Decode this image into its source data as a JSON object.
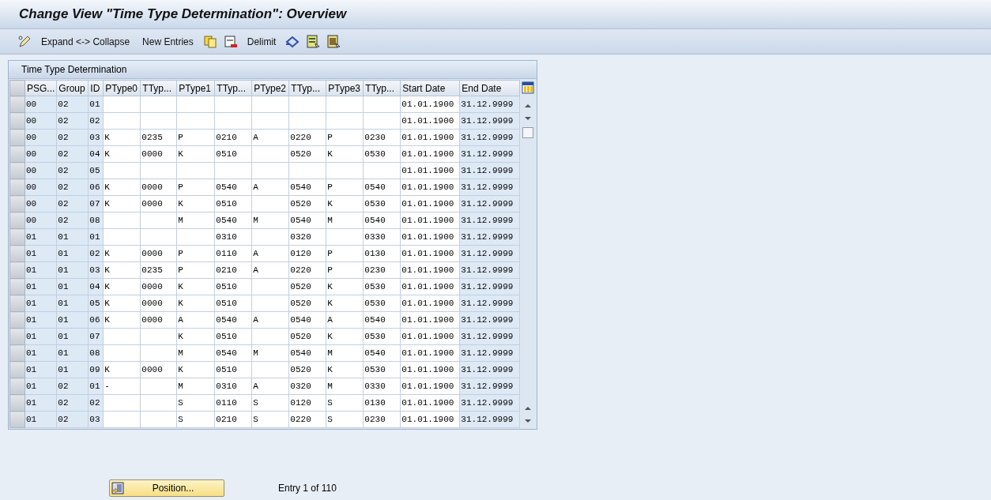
{
  "window": {
    "title": "Change View \"Time Type Determination\": Overview"
  },
  "toolbar": {
    "buttons": [
      "Expand <-> Collapse",
      "New Entries",
      "Delimit"
    ]
  },
  "table": {
    "title": "Time Type Determination",
    "columns": [
      {
        "label": "PSG...",
        "key": true
      },
      {
        "label": "Group",
        "key": true
      },
      {
        "label": "ID",
        "key": true
      },
      {
        "label": "PType0",
        "key": false
      },
      {
        "label": "TTyp...",
        "key": false
      },
      {
        "label": "PType1",
        "key": false
      },
      {
        "label": "TTyp...",
        "key": false
      },
      {
        "label": "PType2",
        "key": false
      },
      {
        "label": "TTyp...",
        "key": false
      },
      {
        "label": "PType3",
        "key": false
      },
      {
        "label": "TTyp...",
        "key": false
      },
      {
        "label": "Start Date",
        "key": false
      },
      {
        "label": "End Date",
        "key": true
      }
    ],
    "rows": [
      [
        "00",
        "02",
        "01",
        null,
        null,
        null,
        null,
        null,
        null,
        null,
        null,
        "01.01.1900",
        "31.12.9999"
      ],
      [
        "00",
        "02",
        "02",
        null,
        null,
        null,
        null,
        null,
        null,
        null,
        null,
        "01.01.1900",
        "31.12.9999"
      ],
      [
        "00",
        "02",
        "03",
        "K",
        "0235",
        "P",
        "0210",
        "A",
        "0220",
        "P",
        "0230",
        "01.01.1900",
        "31.12.9999"
      ],
      [
        "00",
        "02",
        "04",
        "K",
        "0000",
        "K",
        "0510",
        null,
        "0520",
        "K",
        "0530",
        "01.01.1900",
        "31.12.9999"
      ],
      [
        "00",
        "02",
        "05",
        null,
        null,
        null,
        null,
        null,
        null,
        null,
        null,
        "01.01.1900",
        "31.12.9999"
      ],
      [
        "00",
        "02",
        "06",
        "K",
        "0000",
        "P",
        "0540",
        "A",
        "0540",
        "P",
        "0540",
        "01.01.1900",
        "31.12.9999"
      ],
      [
        "00",
        "02",
        "07",
        "K",
        "0000",
        "K",
        "0510",
        null,
        "0520",
        "K",
        "0530",
        "01.01.1900",
        "31.12.9999"
      ],
      [
        "00",
        "02",
        "08",
        null,
        null,
        "M",
        "0540",
        "M",
        "0540",
        "M",
        "0540",
        "01.01.1900",
        "31.12.9999"
      ],
      [
        "01",
        "01",
        "01",
        null,
        null,
        null,
        "0310",
        null,
        "0320",
        null,
        "0330",
        "01.01.1900",
        "31.12.9999"
      ],
      [
        "01",
        "01",
        "02",
        "K",
        "0000",
        "P",
        "0110",
        "A",
        "0120",
        "P",
        "0130",
        "01.01.1900",
        "31.12.9999"
      ],
      [
        "01",
        "01",
        "03",
        "K",
        "0235",
        "P",
        "0210",
        "A",
        "0220",
        "P",
        "0230",
        "01.01.1900",
        "31.12.9999"
      ],
      [
        "01",
        "01",
        "04",
        "K",
        "0000",
        "K",
        "0510",
        null,
        "0520",
        "K",
        "0530",
        "01.01.1900",
        "31.12.9999"
      ],
      [
        "01",
        "01",
        "05",
        "K",
        "0000",
        "K",
        "0510",
        null,
        "0520",
        "K",
        "0530",
        "01.01.1900",
        "31.12.9999"
      ],
      [
        "01",
        "01",
        "06",
        "K",
        "0000",
        "A",
        "0540",
        "A",
        "0540",
        "A",
        "0540",
        "01.01.1900",
        "31.12.9999"
      ],
      [
        "01",
        "01",
        "07",
        null,
        null,
        "K",
        "0510",
        null,
        "0520",
        "K",
        "0530",
        "01.01.1900",
        "31.12.9999"
      ],
      [
        "01",
        "01",
        "08",
        null,
        null,
        "M",
        "0540",
        "M",
        "0540",
        "M",
        "0540",
        "01.01.1900",
        "31.12.9999"
      ],
      [
        "01",
        "01",
        "09",
        "K",
        "0000",
        "K",
        "0510",
        null,
        "0520",
        "K",
        "0530",
        "01.01.1900",
        "31.12.9999"
      ],
      [
        "01",
        "02",
        "01",
        "-",
        null,
        "M",
        "0310",
        "A",
        "0320",
        "M",
        "0330",
        "01.01.1900",
        "31.12.9999"
      ],
      [
        "01",
        "02",
        "02",
        null,
        null,
        "S",
        "0110",
        "S",
        "0120",
        "S",
        "0130",
        "01.01.1900",
        "31.12.9999"
      ],
      [
        "01",
        "02",
        "03",
        null,
        null,
        "S",
        "0210",
        "S",
        "0220",
        "S",
        "0230",
        "01.01.1900",
        "31.12.9999"
      ]
    ]
  },
  "footer": {
    "button": "Position...",
    "entry": "Entry 1 of 110"
  }
}
